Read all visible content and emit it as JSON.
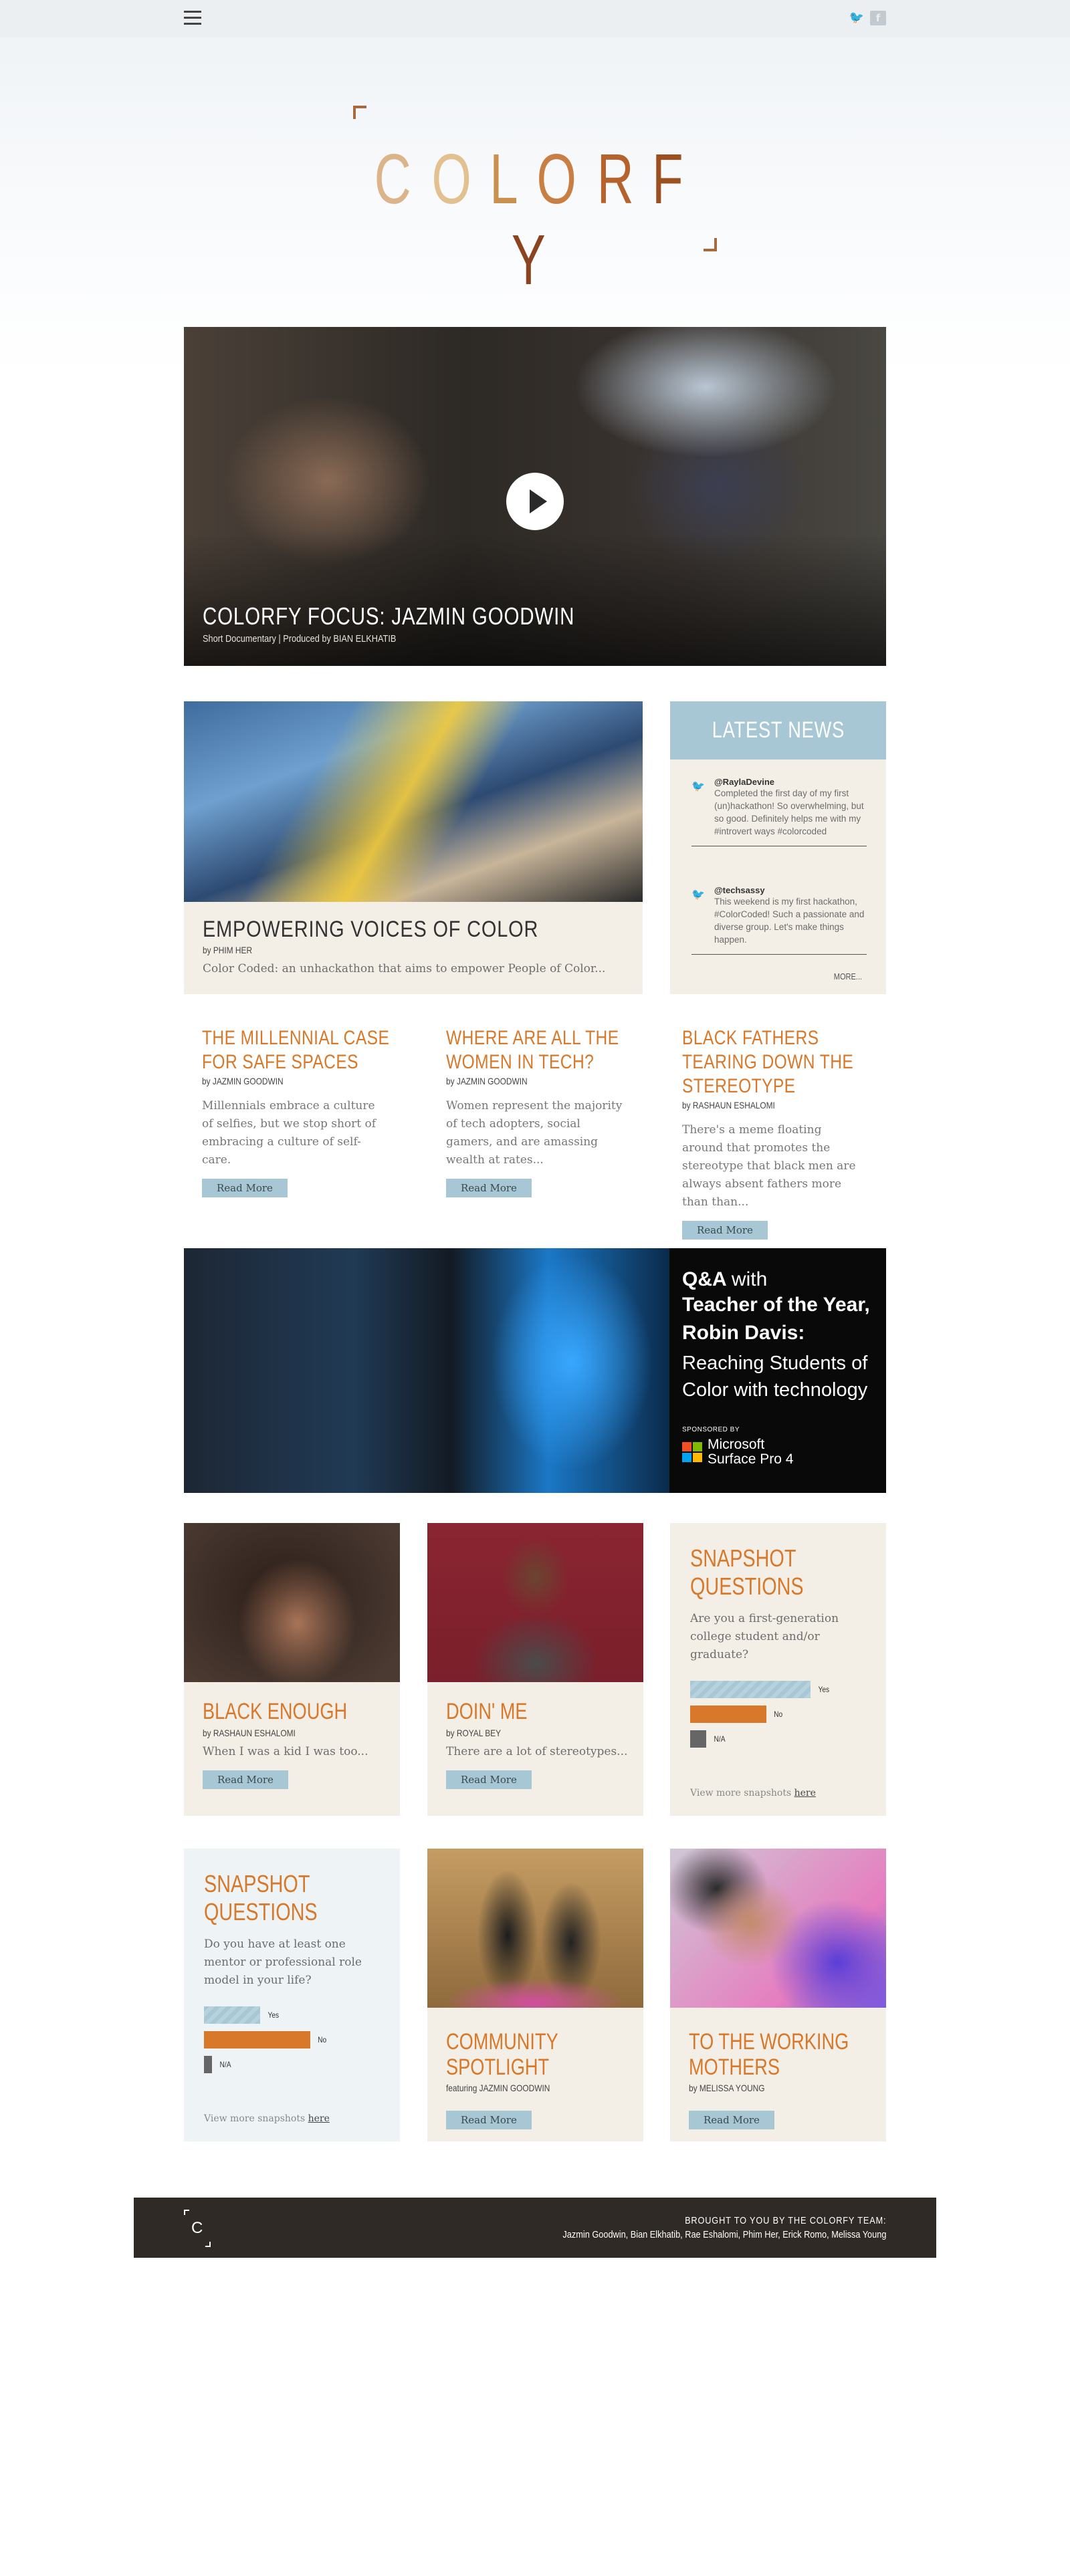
{
  "topbar": {
    "menu_icon": "hamburger-icon",
    "social": [
      "twitter-icon",
      "facebook-icon"
    ],
    "facebook_glyph": "f"
  },
  "logo": {
    "letters": [
      "C",
      "O",
      "L",
      "O",
      "R",
      "F",
      "Y"
    ],
    "colors": [
      "#dcb48a",
      "#e2c08f",
      "#c9914f",
      "#c97f44",
      "#b5622c",
      "#9c5020",
      "#8b4420"
    ]
  },
  "hero": {
    "title": "COLORFY FOCUS: JAZMIN GOODWIN",
    "subtitle": "Short Documentary | Produced by BIAN ELKHATIB",
    "play_icon": "play-icon"
  },
  "feature": {
    "title": "EMPOWERING VOICES OF COLOR",
    "byline": "by PHIM HER",
    "excerpt": "Color Coded: an unhackathon that aims to empower People of Color..."
  },
  "news": {
    "heading": "LATEST NEWS",
    "tweets": [
      {
        "handle": "@RaylaDevine",
        "text": "Completed the first day of my first (un)hackathon! So overwhelming, but so good. Definitely helps me with my #introvert ways #colorcoded"
      },
      {
        "handle": "@techsassy",
        "text": "This weekend is my first hackathon, #ColorCoded! Such a passionate and diverse group. Let's make things happen."
      }
    ],
    "more": "MORE..."
  },
  "articles": [
    {
      "title": "THE MILLENNIAL CASE FOR SAFE SPACES",
      "byline": "by JAZMIN GOODWIN",
      "excerpt": "Millennials embrace a culture of selfies, but we stop short of embracing a culture of self-care.",
      "button": "Read More"
    },
    {
      "title": "WHERE ARE ALL THE WOMEN IN TECH?",
      "byline": "by JAZMIN GOODWIN",
      "excerpt": "Women represent the majority of tech adopters, social gamers, and are amassing wealth at rates...",
      "button": "Read More"
    },
    {
      "title": "BLACK FATHERS TEARING DOWN THE STEREOTYPE",
      "byline": "by RASHAUN ESHALOMI",
      "excerpt": "There's a meme floating around that promotes the stereotype that black men are always absent fathers more than than...",
      "button": "Read More"
    }
  ],
  "banner": {
    "qa": "Q&A",
    "with": "with",
    "line1": "Teacher of the Year,",
    "line2": "Robin Davis:",
    "line3": "Reaching Students of",
    "line4": "Color with technology",
    "sponsored": "SPONSORED BY",
    "brand1": "Microsoft",
    "brand2": "Surface Pro 4",
    "ms_colors": [
      "#f25022",
      "#7fba00",
      "#00a4ef",
      "#ffb900"
    ]
  },
  "tiles": [
    {
      "title": "BLACK ENOUGH",
      "byline": "by RASHAUN ESHALOMI",
      "excerpt": "When I was a kid I was too...",
      "button": "Read More"
    },
    {
      "title": "DOIN' ME",
      "byline": "by ROYAL BEY",
      "excerpt": "There are a lot of stereotypes...",
      "button": "Read More"
    },
    {
      "title": "COMMUNITY SPOTLIGHT",
      "byline": "featuring JAZMIN GOODWIN",
      "button": "Read More"
    },
    {
      "title": "TO THE WORKING MOTHERS",
      "byline": "by MELISSA YOUNG",
      "button": "Read More"
    }
  ],
  "snapshots": [
    {
      "title": "SNAPSHOT QUESTIONS",
      "question": "Are you a first-generation college student and/or graduate?",
      "responses": [
        {
          "label": "Yes",
          "value": 0.6,
          "color": "#a6c7d3"
        },
        {
          "label": "No",
          "value": 0.38,
          "color": "#d8782a"
        },
        {
          "label": "N/A",
          "value": 0.08,
          "color": "#666666"
        }
      ],
      "more_prefix": "View more snapshots ",
      "more_link": "here"
    },
    {
      "title": "SNAPSHOT QUESTIONS",
      "question": "Do you have at least one mentor or professional role model in your life?",
      "responses": [
        {
          "label": "Yes",
          "value": 0.28,
          "color": "#a6c7d3"
        },
        {
          "label": "No",
          "value": 0.53,
          "color": "#d8782a"
        },
        {
          "label": "N/A",
          "value": 0.04,
          "color": "#666666"
        }
      ],
      "more_prefix": "View more snapshots ",
      "more_link": "here"
    }
  ],
  "footer": {
    "logo_letter": "C",
    "heading": "BROUGHT TO YOU BY THE COLORFY TEAM:",
    "names": "Jazmin Goodwin, Bian Elkhatib, Rae Eshalomi, Phim Her, Erick Romo, Melissa Young"
  }
}
